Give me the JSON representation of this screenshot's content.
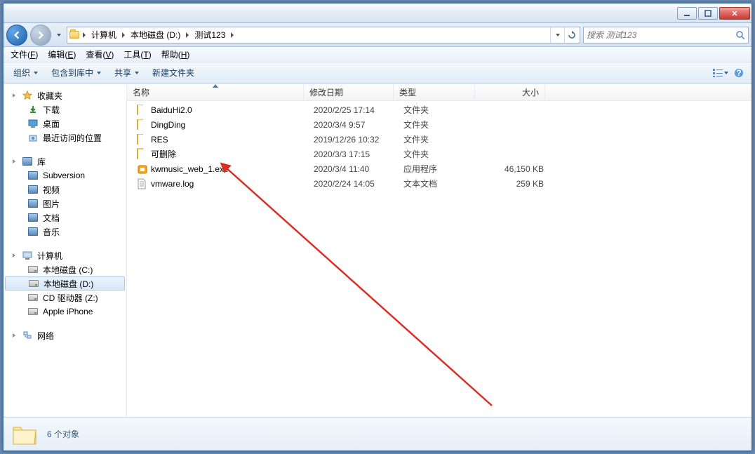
{
  "breadcrumbs": [
    "计算机",
    "本地磁盘 (D:)",
    "测试123"
  ],
  "search_placeholder": "搜索 测试123",
  "menus": [
    {
      "label": "文件",
      "hotkey": "F"
    },
    {
      "label": "编辑",
      "hotkey": "E"
    },
    {
      "label": "查看",
      "hotkey": "V"
    },
    {
      "label": "工具",
      "hotkey": "T"
    },
    {
      "label": "帮助",
      "hotkey": "H"
    }
  ],
  "toolbar": {
    "organize": "组织",
    "include": "包含到库中",
    "share": "共享",
    "newfolder": "新建文件夹"
  },
  "sidebar": {
    "favorites": {
      "label": "收藏夹",
      "items": [
        "下载",
        "桌面",
        "最近访问的位置"
      ]
    },
    "libraries": {
      "label": "库",
      "items": [
        "Subversion",
        "视频",
        "图片",
        "文档",
        "音乐"
      ]
    },
    "computer": {
      "label": "计算机",
      "items": [
        "本地磁盘 (C:)",
        "本地磁盘 (D:)",
        "CD 驱动器 (Z:)",
        "Apple iPhone"
      ],
      "selected_index": 1
    },
    "network": {
      "label": "网络"
    }
  },
  "columns": {
    "name": "名称",
    "date": "修改日期",
    "type": "类型",
    "size": "大小"
  },
  "files": [
    {
      "name": "BaiduHi2.0",
      "date": "2020/2/25 17:14",
      "type": "文件夹",
      "size": "",
      "icon": "folder"
    },
    {
      "name": "DingDing",
      "date": "2020/3/4 9:57",
      "type": "文件夹",
      "size": "",
      "icon": "folder"
    },
    {
      "name": "RES",
      "date": "2019/12/26 10:32",
      "type": "文件夹",
      "size": "",
      "icon": "folder"
    },
    {
      "name": "可删除",
      "date": "2020/3/3 17:15",
      "type": "文件夹",
      "size": "",
      "icon": "folder"
    },
    {
      "name": "kwmusic_web_1.exe",
      "date": "2020/3/4 11:40",
      "type": "应用程序",
      "size": "46,150 KB",
      "icon": "exe"
    },
    {
      "name": "vmware.log",
      "date": "2020/2/24 14:05",
      "type": "文本文档",
      "size": "259 KB",
      "icon": "txt"
    }
  ],
  "status": "6 个对象"
}
